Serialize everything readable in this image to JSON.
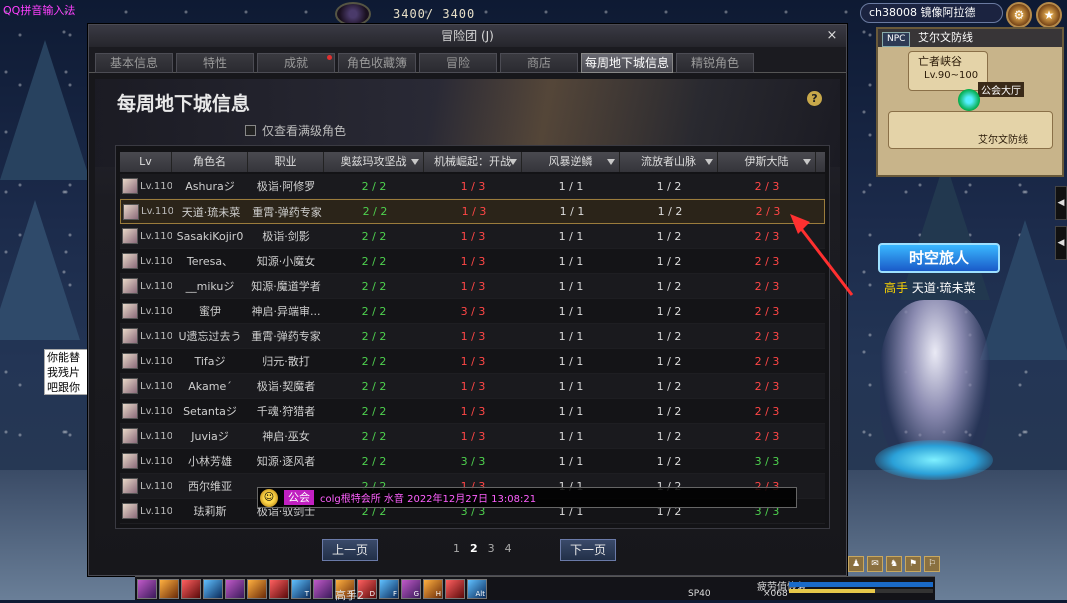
{
  "ime_label": "QQ拼音输入法",
  "hp_display": "3400/ 3400",
  "channel": "ch38008 镜像阿拉德",
  "minimap": {
    "npc_badge": "NPC",
    "zone_name": "艾尔文防线",
    "area_label": "亡者峡谷",
    "level_range": "Lv.90~100",
    "guild_hall": "公会大厅",
    "town_label": "艾尔文防线"
  },
  "window": {
    "title": "冒险团 (J)",
    "close_glyph": "×",
    "tabs": [
      {
        "label": "基本信息",
        "active": false,
        "dot": false
      },
      {
        "label": "特性",
        "active": false,
        "dot": false
      },
      {
        "label": "成就",
        "active": false,
        "dot": true
      },
      {
        "label": "角色收藏簿",
        "active": false,
        "dot": false
      },
      {
        "label": "冒险",
        "active": false,
        "dot": false
      },
      {
        "label": "商店",
        "active": false,
        "dot": false
      },
      {
        "label": "每周地下城信息",
        "active": true,
        "dot": false
      },
      {
        "label": "精锐角色",
        "active": false,
        "dot": false
      }
    ],
    "page_title": "每周地下城信息",
    "help_glyph": "?",
    "filter_label": "仅查看满级角色",
    "columns": [
      "Lv",
      "角色名",
      "职业",
      "奥兹玛攻坚战",
      "机械崛起：开战",
      "风暴逆鳞",
      "流放者山脉",
      "伊斯大陆"
    ],
    "rows": [
      {
        "lv": "Lv.110",
        "name": "Ashuraジ",
        "job": "极诣·阿修罗",
        "c1": "2 / 2",
        "c1c": "green",
        "c2": "1 / 3",
        "c2c": "red",
        "c3": "1 / 1",
        "c3c": "white",
        "c4": "1 / 2",
        "c4c": "white",
        "c5": "2 / 3",
        "c5c": "red"
      },
      {
        "lv": "Lv.110",
        "name": "天道·琉未菜",
        "job": "重霄·弹药专家",
        "c1": "2 / 2",
        "c1c": "green",
        "c2": "1 / 3",
        "c2c": "red",
        "c3": "1 / 1",
        "c3c": "white",
        "c4": "1 / 2",
        "c4c": "white",
        "c5": "2 / 3",
        "c5c": "red",
        "highlight": true
      },
      {
        "lv": "Lv.110",
        "name": "SasakiKojir0",
        "job": "极诣·剑影",
        "c1": "2 / 2",
        "c1c": "green",
        "c2": "1 / 3",
        "c2c": "red",
        "c3": "1 / 1",
        "c3c": "white",
        "c4": "1 / 2",
        "c4c": "white",
        "c5": "2 / 3",
        "c5c": "red"
      },
      {
        "lv": "Lv.110",
        "name": "Teresa、",
        "job": "知源·小魔女",
        "c1": "2 / 2",
        "c1c": "green",
        "c2": "1 / 3",
        "c2c": "red",
        "c3": "1 / 1",
        "c3c": "white",
        "c4": "1 / 2",
        "c4c": "white",
        "c5": "2 / 3",
        "c5c": "red"
      },
      {
        "lv": "Lv.110",
        "name": "__mikuジ",
        "job": "知源·魔道学者",
        "c1": "2 / 2",
        "c1c": "green",
        "c2": "1 / 3",
        "c2c": "red",
        "c3": "1 / 1",
        "c3c": "white",
        "c4": "1 / 2",
        "c4c": "white",
        "c5": "2 / 3",
        "c5c": "red"
      },
      {
        "lv": "Lv.110",
        "name": "蜜伊",
        "job": "神启·异端审...",
        "c1": "2 / 2",
        "c1c": "green",
        "c2": "3 / 3",
        "c2c": "red",
        "c3": "1 / 1",
        "c3c": "white",
        "c4": "1 / 2",
        "c4c": "white",
        "c5": "2 / 3",
        "c5c": "red"
      },
      {
        "lv": "Lv.110",
        "name": "U遗忘过去う",
        "job": "重霄·弹药专家",
        "c1": "2 / 2",
        "c1c": "green",
        "c2": "1 / 3",
        "c2c": "red",
        "c3": "1 / 1",
        "c3c": "white",
        "c4": "1 / 2",
        "c4c": "white",
        "c5": "2 / 3",
        "c5c": "red"
      },
      {
        "lv": "Lv.110",
        "name": "Tifaジ",
        "job": "归元·散打",
        "c1": "2 / 2",
        "c1c": "green",
        "c2": "1 / 3",
        "c2c": "red",
        "c3": "1 / 1",
        "c3c": "white",
        "c4": "1 / 2",
        "c4c": "white",
        "c5": "2 / 3",
        "c5c": "red"
      },
      {
        "lv": "Lv.110",
        "name": "Akame´",
        "job": "极诣·契魔者",
        "c1": "2 / 2",
        "c1c": "green",
        "c2": "1 / 3",
        "c2c": "red",
        "c3": "1 / 1",
        "c3c": "white",
        "c4": "1 / 2",
        "c4c": "white",
        "c5": "2 / 3",
        "c5c": "red"
      },
      {
        "lv": "Lv.110",
        "name": "Setantaジ",
        "job": "千魂·狩猎者",
        "c1": "2 / 2",
        "c1c": "green",
        "c2": "1 / 3",
        "c2c": "red",
        "c3": "1 / 1",
        "c3c": "white",
        "c4": "1 / 2",
        "c4c": "white",
        "c5": "2 / 3",
        "c5c": "red"
      },
      {
        "lv": "Lv.110",
        "name": "Juviaジ",
        "job": "神启·巫女",
        "c1": "2 / 2",
        "c1c": "green",
        "c2": "1 / 3",
        "c2c": "red",
        "c3": "1 / 1",
        "c3c": "white",
        "c4": "1 / 2",
        "c4c": "white",
        "c5": "2 / 3",
        "c5c": "red"
      },
      {
        "lv": "Lv.110",
        "name": "小林芳雄",
        "job": "知源·逐风者",
        "c1": "2 / 2",
        "c1c": "green",
        "c2": "3 / 3",
        "c2c": "green",
        "c3": "1 / 1",
        "c3c": "white",
        "c4": "1 / 2",
        "c4c": "white",
        "c5": "3 / 3",
        "c5c": "green"
      },
      {
        "lv": "Lv.110",
        "name": "西尔维亚",
        "job": "",
        "c1": "2 / 2",
        "c1c": "green",
        "c2": "1 / 3",
        "c2c": "red",
        "c3": "1 / 1",
        "c3c": "white",
        "c4": "1 / 2",
        "c4c": "white",
        "c5": "2 / 3",
        "c5c": "red"
      },
      {
        "lv": "Lv.110",
        "name": "珐莉斯",
        "job": "极诣·驭剑士",
        "c1": "2 / 2",
        "c1c": "green",
        "c2": "3 / 3",
        "c2c": "green",
        "c3": "1 / 1",
        "c3c": "white",
        "c4": "1 / 2",
        "c4c": "white",
        "c5": "3 / 3",
        "c5c": "green"
      }
    ],
    "prev_label": "上一页",
    "next_label": "下一页",
    "pages": [
      "1",
      "2",
      "3",
      "4"
    ],
    "current_page": "2"
  },
  "guild_message": {
    "tag": "公会",
    "text": "colg根特会所  水音  2022年12月27日 13:08:21"
  },
  "speech_text": "你能替我残片吧跟你换!",
  "timeboard_label": "时空旅人",
  "player": {
    "title": "高手",
    "name": "天道·琉未菜"
  },
  "bottom": {
    "name": "高手2",
    "sp": "SP40",
    "status": "疲劳值恢复",
    "coin": "×068"
  },
  "skill_keys": [
    "",
    "",
    "",
    "",
    "",
    "",
    "",
    "T",
    "",
    "S",
    "D",
    "F",
    "G",
    "H",
    "",
    "Alt"
  ],
  "hotkey_glyphs": [
    "♟",
    "✉",
    "♞",
    "⚑",
    "⚐"
  ],
  "colors": {
    "green": "#4ed24e",
    "red": "#ff4646",
    "accent": "#9b7c3c"
  }
}
